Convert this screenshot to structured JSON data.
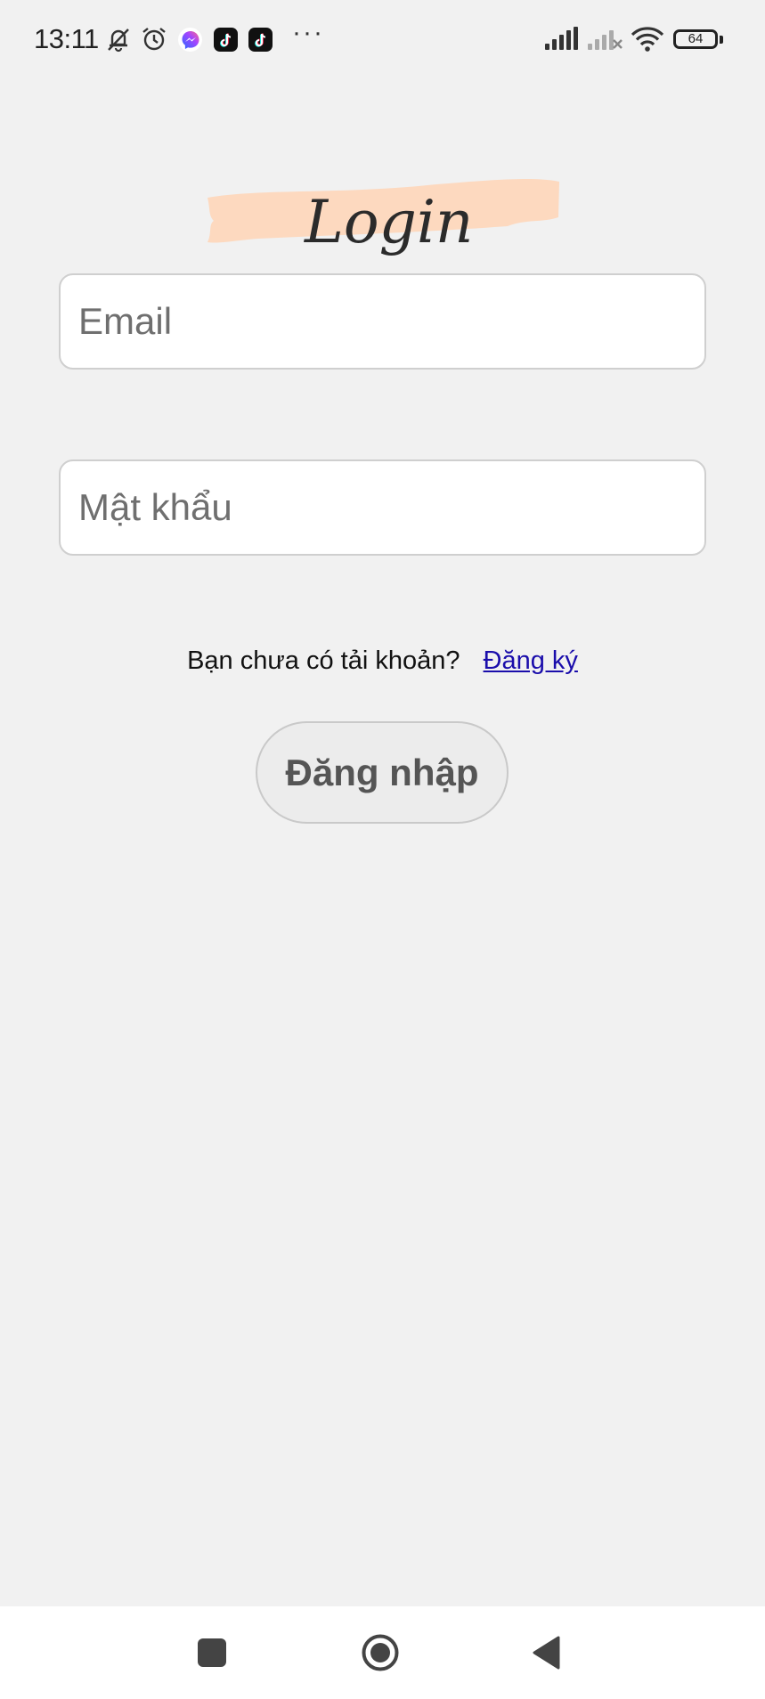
{
  "status_bar": {
    "time": "13:11",
    "battery_level": "64",
    "icons": [
      "bell-off-icon",
      "alarm-icon",
      "messenger-icon",
      "tiktok-icon",
      "tiktok-icon",
      "more-icon",
      "signal-icon",
      "signal-no-service-icon",
      "wifi-icon",
      "battery-icon"
    ],
    "more": "···"
  },
  "logo": {
    "text": "Login",
    "brush_color": "#fdd9bf"
  },
  "form": {
    "email_placeholder": "Email",
    "email_value": "",
    "password_placeholder": "Mật khẩu",
    "password_value": ""
  },
  "register": {
    "prompt": "Bạn chưa có tải khoản?",
    "link_label": "Đăng ký"
  },
  "login_button": {
    "label": "Đăng nhập"
  },
  "nav_bar": {
    "items": [
      "recent-apps",
      "home",
      "back"
    ]
  }
}
